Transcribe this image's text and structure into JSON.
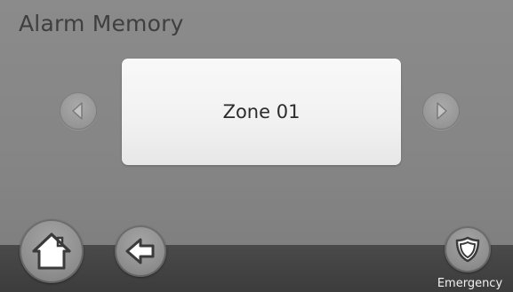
{
  "screen": {
    "title": "Alarm Memory",
    "panel_text": "Zone 01"
  },
  "navigation": {
    "prev_icon": "chevron-left-icon",
    "next_icon": "chevron-right-icon"
  },
  "bottom_bar": {
    "home_icon": "home-icon",
    "back_icon": "back-arrow-icon",
    "emergency_icon": "shield-icon",
    "emergency_label": "Emergency"
  },
  "colors": {
    "background": "#858585",
    "panel": "#f2f2f2",
    "bottom_bar": "#404040",
    "icon_fill": "#ffffff",
    "icon_outline": "#3a3a3a"
  }
}
